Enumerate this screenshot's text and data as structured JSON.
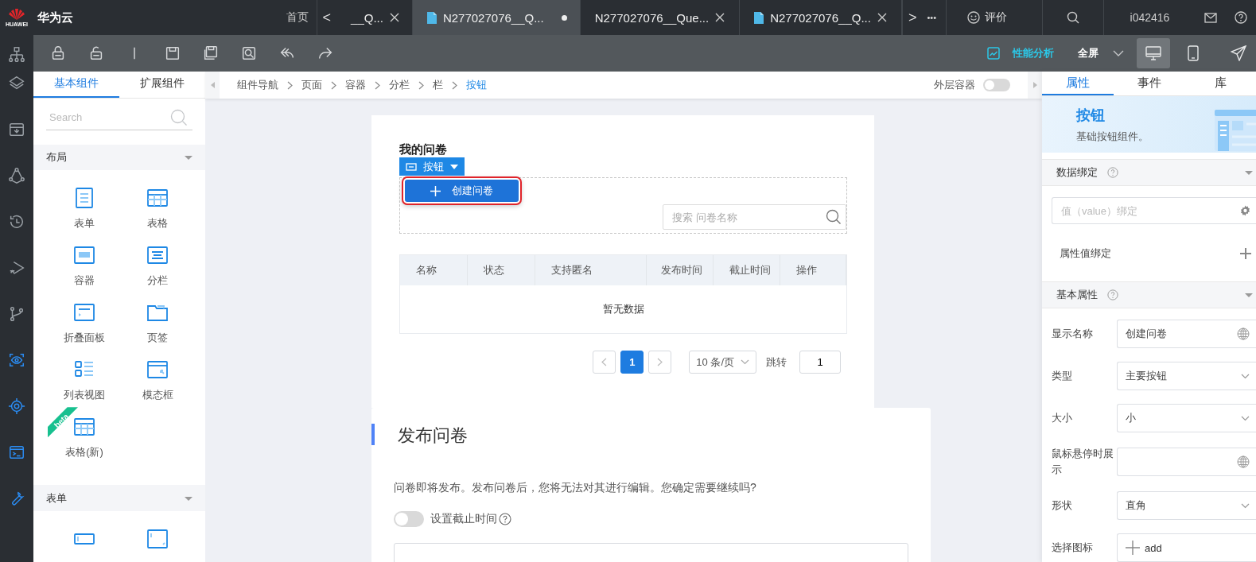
{
  "top_bar": {
    "brand": "HUAWEI",
    "product": "华为云",
    "home": "首页",
    "prev": "<",
    "next": ">",
    "more": "•••",
    "tabs": [
      {
        "label": "__Q...",
        "selected": false,
        "modified": false,
        "has_icon": false
      },
      {
        "label": "N277027076__Q...",
        "selected": true,
        "modified": true,
        "has_icon": true
      },
      {
        "label": "N277027076__Que...",
        "selected": false,
        "modified": false,
        "has_icon": false
      },
      {
        "label": "N277027076__Q...",
        "selected": false,
        "modified": false,
        "has_icon": true
      }
    ],
    "rate": "评价",
    "user": "i042416"
  },
  "toolbar": {
    "perf": "性能分析",
    "fullscreen": "全屏",
    "devices": [
      {
        "selected": true
      },
      {
        "selected": false
      }
    ]
  },
  "left_panel": {
    "tabs": [
      {
        "label": "基本组件",
        "selected": true
      },
      {
        "label": "扩展组件",
        "selected": false
      }
    ],
    "search": {
      "placeholder": "Search"
    },
    "sections": [
      {
        "title": "布局",
        "expanded": true,
        "items": [
          {
            "kind": "form",
            "label": "表单"
          },
          {
            "kind": "table",
            "label": "表格"
          },
          {
            "kind": "container",
            "label": "容器"
          },
          {
            "kind": "columns",
            "label": "分栏"
          },
          {
            "kind": "collapse",
            "label": "折叠面板"
          },
          {
            "kind": "tabs",
            "label": "页签"
          },
          {
            "kind": "list",
            "label": "列表视图"
          },
          {
            "kind": "modal",
            "label": "模态框"
          },
          {
            "kind": "table",
            "label": "表格(新)",
            "badge": "beta"
          }
        ]
      },
      {
        "title": "表单",
        "expanded": true,
        "items": [
          {
            "kind": "input"
          },
          {
            "kind": "textarea"
          }
        ]
      }
    ]
  },
  "breadcrumb": {
    "items": [
      {
        "label": "组件导航",
        "selected": false
      },
      {
        "label": "页面",
        "selected": false
      },
      {
        "label": "容器",
        "selected": false
      },
      {
        "label": "分栏",
        "selected": false
      },
      {
        "label": "栏",
        "selected": false
      },
      {
        "label": "按钮",
        "selected": true
      }
    ],
    "outer_container": {
      "label": "外层容器",
      "on": false
    }
  },
  "canvas": {
    "list_card": {
      "title": "我的问卷",
      "selection_tag": "按钮",
      "create_button": "创建问卷",
      "search": {
        "placeholder": "搜索 问卷名称"
      },
      "columns": [
        "名称",
        "状态",
        "支持匿名",
        "发布时间",
        "截止时间",
        "操作"
      ],
      "empty": "暂无数据",
      "pagination": {
        "pages": [
          {
            "label": "1",
            "selected": true
          }
        ],
        "page_size": "10 条/页",
        "goto_label": "跳转",
        "goto_value": "1"
      }
    },
    "publish_card": {
      "title": "发布问卷",
      "message": "问卷即将发布。发布问卷后，您将无法对其进行编辑。您确定需要继续吗?",
      "deadline": {
        "label": "设置截止时间",
        "on": false
      }
    }
  },
  "right_panel": {
    "tabs": [
      {
        "label": "属性",
        "selected": true
      },
      {
        "label": "事件",
        "selected": false
      },
      {
        "label": "库",
        "selected": false
      }
    ],
    "header": {
      "title": "按钮",
      "subtitle": "基础按钮组件。"
    },
    "data_binding": {
      "title": "数据绑定",
      "expanded": true,
      "value_placeholder": "值（value）绑定",
      "attr_binding": "属性值绑定"
    },
    "basic": {
      "title": "基本属性",
      "expanded": true,
      "fields": [
        {
          "label": "显示名称",
          "kind": "text",
          "value": "创建问卷"
        },
        {
          "label": "类型",
          "kind": "select",
          "value": "主要按钮"
        },
        {
          "label": "大小",
          "kind": "select",
          "value": "小"
        },
        {
          "label": "鼠标悬停时展示",
          "kind": "text"
        },
        {
          "label": "形状",
          "kind": "select",
          "value": "直角"
        },
        {
          "label": "选择图标",
          "kind": "icon",
          "value": "add"
        }
      ]
    }
  }
}
